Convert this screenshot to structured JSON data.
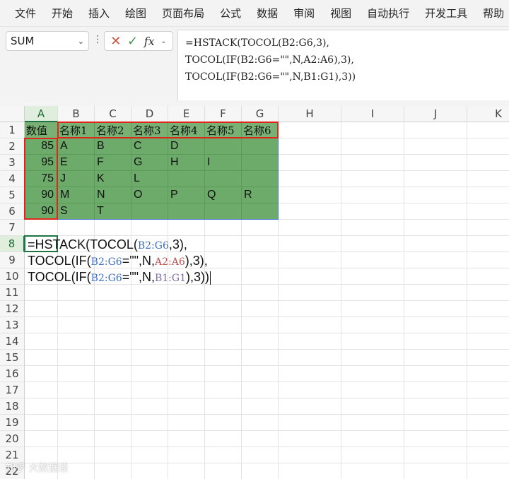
{
  "menu": [
    "文件",
    "开始",
    "插入",
    "绘图",
    "页面布局",
    "公式",
    "数据",
    "审阅",
    "视图",
    "自动执行",
    "开发工具",
    "帮助"
  ],
  "namebox": {
    "value": "SUM"
  },
  "formula_bar": {
    "lines": [
      "=HSTACK(TOCOL(B2:G6,3),",
      "TOCOL(IF(B2:G6=\"\",N,A2:A6),3),",
      "TOCOL(IF(B2:G6=\"\",N,B1:G1),3))"
    ]
  },
  "grid": {
    "columns": [
      "A",
      "B",
      "C",
      "D",
      "E",
      "F",
      "G",
      "H",
      "I",
      "J",
      "K"
    ],
    "rows": [
      "1",
      "2",
      "3",
      "4",
      "5",
      "6",
      "7",
      "8",
      "9",
      "10",
      "11",
      "12",
      "13",
      "14",
      "15",
      "16",
      "17",
      "18",
      "19",
      "20",
      "21",
      "22"
    ],
    "data": [
      [
        "数值",
        "名称1",
        "名称2",
        "名称3",
        "名称4",
        "名称5",
        "名称6"
      ],
      [
        "85",
        "A",
        "B",
        "C",
        "D",
        "",
        ""
      ],
      [
        "95",
        "E",
        "F",
        "G",
        "H",
        "I",
        ""
      ],
      [
        "75",
        "J",
        "K",
        "L",
        "",
        "",
        ""
      ],
      [
        "90",
        "M",
        "N",
        "O",
        "P",
        "Q",
        "R"
      ],
      [
        "90",
        "S",
        "T",
        "",
        "",
        "",
        ""
      ]
    ]
  },
  "in_cell_edit": {
    "line1": {
      "a": "=HSTACK(TOCOL(",
      "ref1": "B2:G6",
      "b": ",3),"
    },
    "line2": {
      "a": "TOCOL(IF(",
      "ref1": "B2:G6",
      "b": "=\"\",N,",
      "ref2": "A2:A6",
      "c": "),3),"
    },
    "line3": {
      "a": "TOCOL(IF(",
      "ref1": "B2:G6",
      "b": "=\"\",N,",
      "ref2": "B1:G1",
      "c": "),3))"
    }
  },
  "watermark": "知乎 大数据谈"
}
